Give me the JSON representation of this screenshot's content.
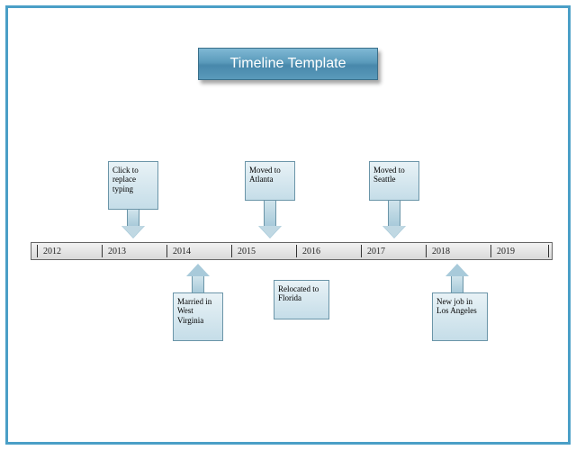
{
  "title": "Timeline Template",
  "chart_data": {
    "type": "timeline",
    "years": [
      2012,
      2013,
      2014,
      2015,
      2016,
      2017,
      2018,
      2019
    ],
    "events_above": [
      {
        "between": [
          2013,
          2014
        ],
        "text": "Click to replace typing"
      },
      {
        "between": [
          2015,
          2016
        ],
        "text": "Moved to Atlanta"
      },
      {
        "between": [
          2016,
          2017
        ],
        "text": "Moved to Seattle"
      }
    ],
    "events_below": [
      {
        "between": [
          2014,
          2015
        ],
        "text": "Married in West Virginia"
      },
      {
        "at": 2016,
        "text": "Relocated to Florida"
      },
      {
        "between": [
          2017,
          2018
        ],
        "text": "New job in Los Angeles"
      }
    ]
  },
  "colors": {
    "frame": "#4a9fc7",
    "title_bg": "#5a9abb",
    "callout_bg": "#c5dde8"
  }
}
